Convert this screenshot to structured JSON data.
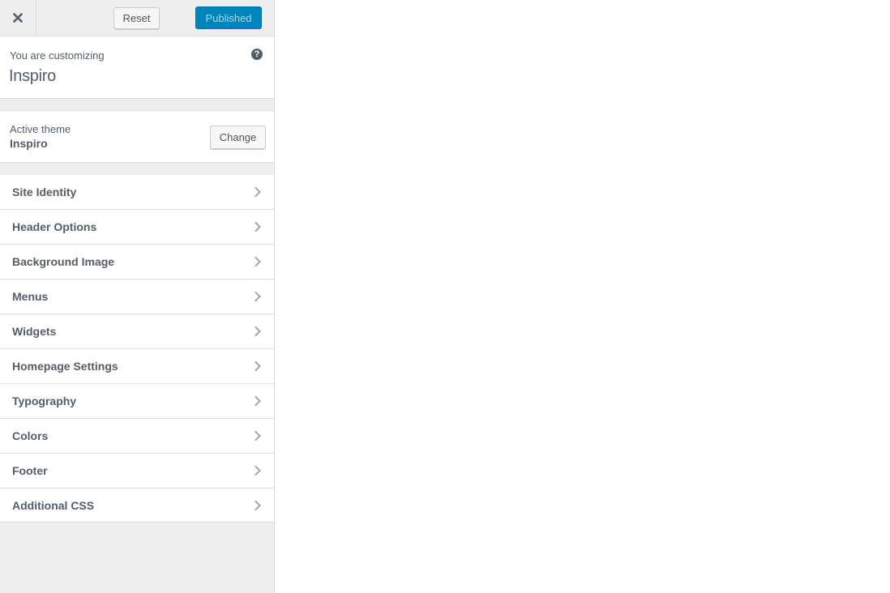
{
  "header": {
    "close_icon": "close-icon",
    "reset_label": "Reset",
    "publish_label": "Published"
  },
  "info": {
    "pre_title": "You are customizing",
    "title": "Inspiro",
    "help_icon": "help-icon",
    "help_glyph": "?"
  },
  "theme": {
    "label": "Active theme",
    "name": "Inspiro",
    "change_label": "Change"
  },
  "sections": [
    {
      "label": "Site Identity"
    },
    {
      "label": "Header Options"
    },
    {
      "label": "Background Image"
    },
    {
      "label": "Menus"
    },
    {
      "label": "Widgets"
    },
    {
      "label": "Homepage Settings"
    },
    {
      "label": "Typography"
    },
    {
      "label": "Colors"
    },
    {
      "label": "Footer"
    },
    {
      "label": "Additional CSS"
    }
  ],
  "colors": {
    "accent": "#0085ba",
    "sidebar_bg": "#eeeeee",
    "text": "#555d66"
  }
}
